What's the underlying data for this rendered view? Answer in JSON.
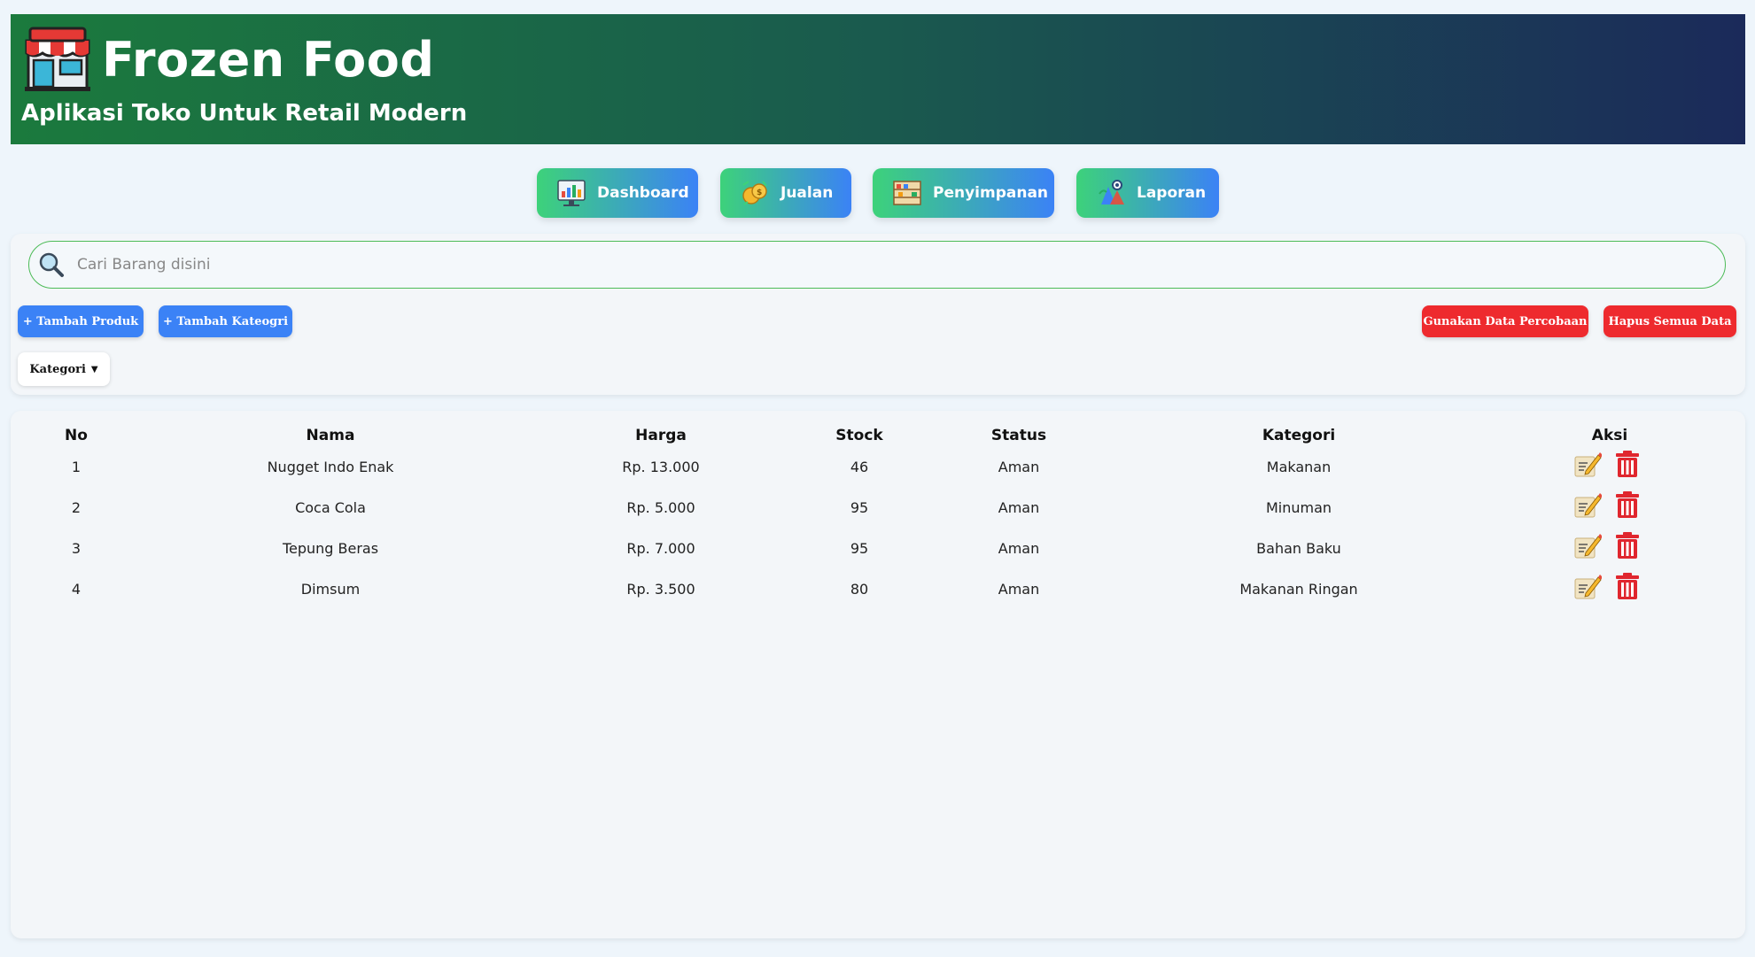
{
  "header": {
    "title": "Frozen Food",
    "subtitle": "Aplikasi Toko Untuk Retail Modern",
    "logo_icon": "store-awning-icon"
  },
  "nav": [
    {
      "label": "Dashboard",
      "icon": "dashboard-chart-icon"
    },
    {
      "label": "Jualan",
      "icon": "money-icon"
    },
    {
      "label": "Penyimpanan",
      "icon": "shelf-icon"
    },
    {
      "label": "Laporan",
      "icon": "report-icon"
    }
  ],
  "search": {
    "placeholder": "Cari Barang disini",
    "value": ""
  },
  "toolbar": {
    "add_product": "+ Tambah Produk",
    "add_category": "+ Tambah Kateogri",
    "use_sample": "Gunakan Data Percobaan",
    "delete_all": "Hapus Semua Data",
    "category_filter": "Kategori",
    "primary_color": "#3b82f6",
    "danger_color": "#ee2a2e"
  },
  "table": {
    "headers": [
      "No",
      "Nama",
      "Harga",
      "Stock",
      "Status",
      "Kategori",
      "Aksi"
    ],
    "rows": [
      {
        "no": "1",
        "nama": "Nugget Indo Enak",
        "harga": "Rp. 13.000",
        "stock": "46",
        "status": "Aman",
        "kategori": "Makanan"
      },
      {
        "no": "2",
        "nama": "Coca Cola",
        "harga": "Rp. 5.000",
        "stock": "95",
        "status": "Aman",
        "kategori": "Minuman"
      },
      {
        "no": "3",
        "nama": "Tepung Beras",
        "harga": "Rp. 7.000",
        "stock": "95",
        "status": "Aman",
        "kategori": "Bahan Baku"
      },
      {
        "no": "4",
        "nama": "Dimsum",
        "harga": "Rp. 3.500",
        "stock": "80",
        "status": "Aman",
        "kategori": "Makanan Ringan"
      }
    ],
    "action_icons": [
      "edit-note-icon",
      "trash-icon"
    ]
  }
}
